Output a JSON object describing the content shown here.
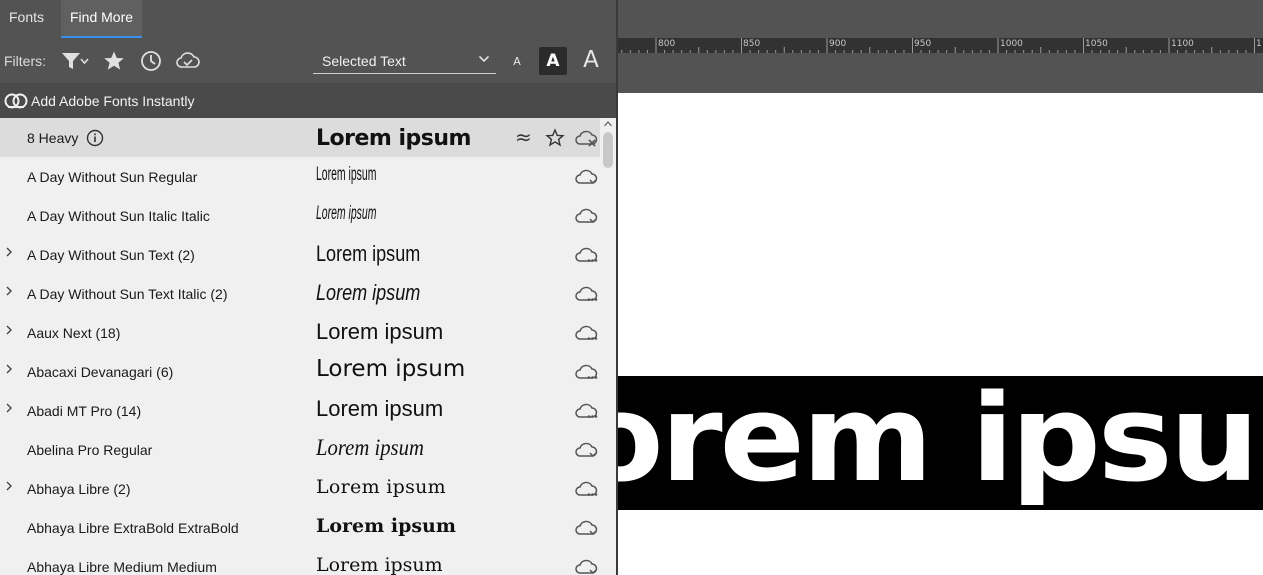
{
  "tabs": {
    "fonts": "Fonts",
    "find_more": "Find More"
  },
  "filters": {
    "label": "Filters:",
    "icons": [
      "filter-classification-icon",
      "favorites-star-icon",
      "recently-added-clock-icon",
      "cloud-activated-icon"
    ]
  },
  "sample_text_select": {
    "value": "Selected Text"
  },
  "size_buttons": {
    "small": "A",
    "medium": "A",
    "large": "A"
  },
  "adobe_fonts": {
    "label": "Add Adobe Fonts Instantly"
  },
  "font_rows": [
    {
      "name": "8 Heavy",
      "sample": "Lorem ipsum",
      "expandable": false,
      "selected": true
    },
    {
      "name": "A Day Without Sun Regular",
      "sample": "Lorem ipsum",
      "expandable": false
    },
    {
      "name": "A Day Without Sun Italic Italic",
      "sample": "Lorem ipsum",
      "expandable": false
    },
    {
      "name": "A Day Without Sun Text (2)",
      "sample": "Lorem ipsum",
      "expandable": true
    },
    {
      "name": "A Day Without Sun Text Italic (2)",
      "sample": "Lorem ipsum",
      "expandable": true
    },
    {
      "name": "Aaux Next (18)",
      "sample": "Lorem ipsum",
      "expandable": true
    },
    {
      "name": "Abacaxi Devanagari (6)",
      "sample": "Lorem ipsum",
      "expandable": true
    },
    {
      "name": "Abadi MT Pro (14)",
      "sample": "Lorem ipsum",
      "expandable": true
    },
    {
      "name": "Abelina Pro Regular",
      "sample": "Lorem ipsum",
      "expandable": false
    },
    {
      "name": "Abhaya Libre (2)",
      "sample": "Lorem ipsum",
      "expandable": true
    },
    {
      "name": "Abhaya Libre ExtraBold ExtraBold",
      "sample": "Lorem ipsum",
      "expandable": false
    },
    {
      "name": "Abhaya Libre Medium Medium",
      "sample": "Lorem ipsum",
      "expandable": false
    }
  ],
  "ruler": {
    "labels": [
      "800",
      "850",
      "900",
      "950",
      "1000",
      "1050",
      "1100",
      "1"
    ]
  },
  "canvas": {
    "text": "Lorem ipsum"
  },
  "colors": {
    "panel_dark": "#535353",
    "tab_accent": "#3b8eea",
    "list_bg": "#f0f0f0",
    "selected_row": "#dcdcdc"
  }
}
